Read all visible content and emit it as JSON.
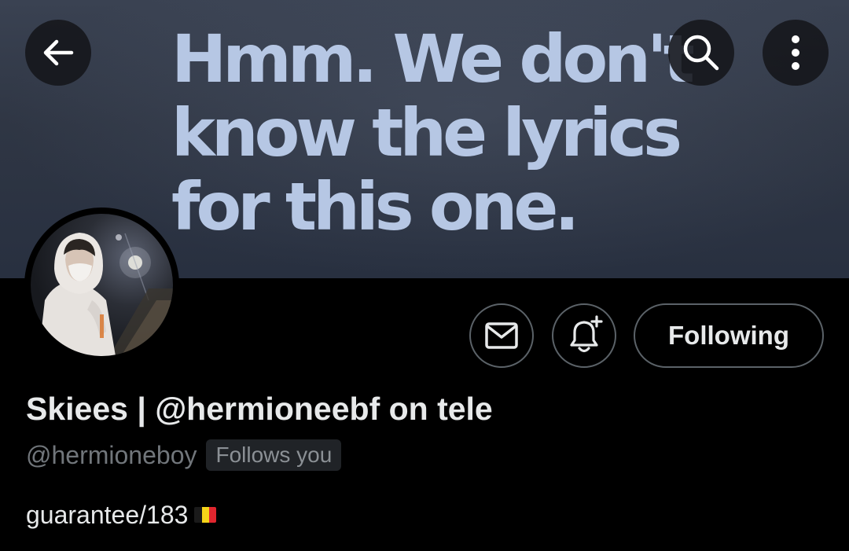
{
  "banner": {
    "text": "Hmm. We don't\nknow the lyrics\nfor this one."
  },
  "nav": {
    "back_icon": "arrow-left-icon",
    "search_icon": "search-icon",
    "more_icon": "more-vertical-icon"
  },
  "actions": {
    "message_icon": "envelope-icon",
    "notify_icon": "bell-plus-icon",
    "following_label": "Following"
  },
  "profile": {
    "display_name": "Skiees | @hermioneebf on tele",
    "handle": "@hermioneboy",
    "follows_badge": "Follows you",
    "bio": "guarantee/183",
    "bio_flag_icon": "belgium-flag-icon"
  },
  "colors": {
    "background": "#000000",
    "primary_text": "#e7e9ea",
    "secondary_text": "#71767b",
    "border": "#5b6268",
    "banner_text": "#b6c7e4",
    "flag": [
      "#1a1a1a",
      "#f5d419",
      "#e0262e"
    ]
  }
}
